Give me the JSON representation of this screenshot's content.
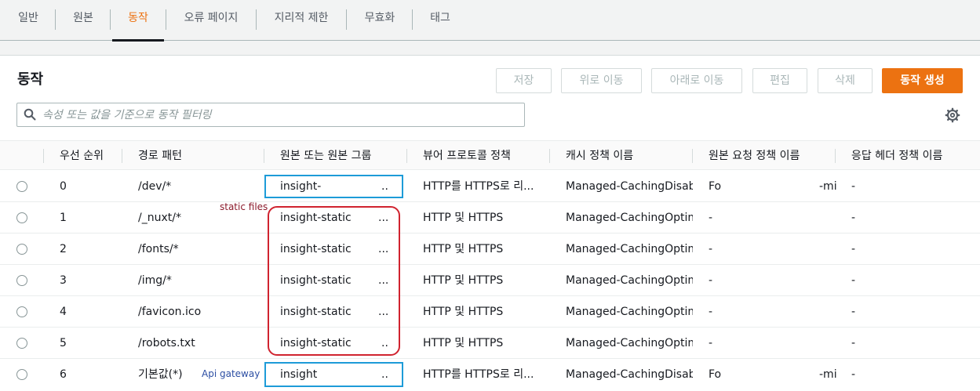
{
  "tabs": [
    "일반",
    "원본",
    "동작",
    "오류 페이지",
    "지리적 제한",
    "무효화",
    "태그"
  ],
  "panel": {
    "title": "동작",
    "buttons": {
      "save": "저장",
      "move_up": "위로 이동",
      "move_down": "아래로 이동",
      "edit": "편집",
      "delete": "삭제",
      "create": "동작 생성"
    },
    "search_placeholder": "속성 또는 값을 기준으로 동작 필터링"
  },
  "table": {
    "headers": [
      "우선 순위",
      "경로 패턴",
      "원본 또는 원본 그룹",
      "뷰어 프로토콜 정책",
      "캐시 정책 이름",
      "원본 요청 정책 이름",
      "응답 헤더 정책 이름"
    ],
    "rows": [
      {
        "priority": "0",
        "path": "/dev/*",
        "origin": "insight-",
        "origin_more": "..",
        "viewer": "HTTP를 HTTPS로 리...",
        "cache": "Managed-CachingDisabled",
        "origin_req": "Fo",
        "origin_req_tail": "-mi",
        "resp": "-"
      },
      {
        "priority": "1",
        "path": "/_nuxt/*",
        "origin": "insight-static",
        "origin_more": "...",
        "viewer": "HTTP 및 HTTPS",
        "cache": "Managed-CachingOptimized",
        "origin_req": "-",
        "origin_req_tail": "",
        "resp": "-"
      },
      {
        "priority": "2",
        "path": "/fonts/*",
        "origin": "insight-static",
        "origin_more": "...",
        "viewer": "HTTP 및 HTTPS",
        "cache": "Managed-CachingOptimized",
        "origin_req": "-",
        "origin_req_tail": "",
        "resp": "-"
      },
      {
        "priority": "3",
        "path": "/img/*",
        "origin": "insight-static",
        "origin_more": "...",
        "viewer": "HTTP 및 HTTPS",
        "cache": "Managed-CachingOptimized",
        "origin_req": "-",
        "origin_req_tail": "",
        "resp": "-"
      },
      {
        "priority": "4",
        "path": "/favicon.ico",
        "origin": "insight-static",
        "origin_more": "...",
        "viewer": "HTTP 및 HTTPS",
        "cache": "Managed-CachingOptimized",
        "origin_req": "-",
        "origin_req_tail": "",
        "resp": "-"
      },
      {
        "priority": "5",
        "path": "/robots.txt",
        "origin": "insight-static",
        "origin_more": "..",
        "viewer": "HTTP 및 HTTPS",
        "cache": "Managed-CachingOptimized",
        "origin_req": "-",
        "origin_req_tail": "",
        "resp": "-"
      },
      {
        "priority": "6",
        "path": "기본값(*)",
        "origin": "insight",
        "origin_more": "..",
        "viewer": "HTTP를 HTTPS로 리...",
        "cache": "Managed-CachingDisabled",
        "origin_req": "Fo",
        "origin_req_tail": "-mi",
        "resp": "-"
      }
    ]
  },
  "annotations": {
    "static_files": "static files",
    "api_gateway": "Api gateway"
  },
  "colors": {
    "accent": "#ec7211",
    "annotation_red": "#d0232f",
    "annotation_blue": "#1d9bd8",
    "annotation_text_blue": "#2c4ea3",
    "annotation_text_red": "#8b1a2b"
  },
  "icons": {
    "search": "search-icon",
    "settings": "gear-icon",
    "row_select": "radio-button"
  }
}
